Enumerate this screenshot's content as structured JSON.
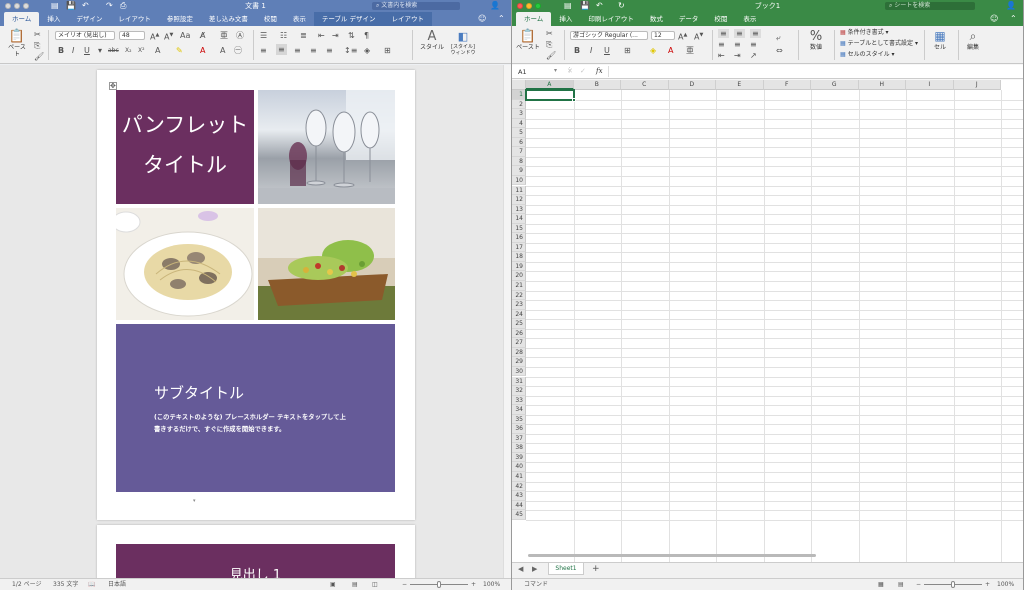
{
  "word": {
    "title": "文書 1",
    "search_placeholder": "文書内を検索",
    "tabs": [
      "ホーム",
      "挿入",
      "デザイン",
      "レイアウト",
      "参照設定",
      "差し込み文書",
      "校閲",
      "表示",
      "テーブル デザイン",
      "レイアウト"
    ],
    "active_tab_index": 0,
    "ribbon": {
      "paste_label": "ペースト",
      "font_name": "メイリオ (見出し)",
      "font_size": "48",
      "styles_label": "スタイル",
      "styles_window_label": "[スタイル]\nウィンドウ"
    },
    "document": {
      "cover_title_line1": "パンフレット",
      "cover_title_line2": "タイトル",
      "subtitle": "サブタイトル",
      "body_line1": "(このテキストのような) プレースホルダー テキストをタップして上",
      "body_line2": "書きするだけで、すぐに作成を開始できます。",
      "heading1": "見出し 1"
    },
    "status": {
      "page": "1/2 ページ",
      "words": "335 文字",
      "language": "日本語",
      "zoom": "100%"
    },
    "colors": {
      "cover": "#6b2f60",
      "subtitle_panel": "#655a98",
      "brand": "#2b579a"
    }
  },
  "excel": {
    "title": "ブック1",
    "search_placeholder": "シートを検索",
    "tabs": [
      "ホーム",
      "挿入",
      "印刷レイアウト",
      "数式",
      "データ",
      "校閲",
      "表示"
    ],
    "active_tab_index": 0,
    "ribbon": {
      "paste_label": "ペースト",
      "font_name": "游ゴシック Regular (...",
      "font_size": "12",
      "number_label": "数値",
      "conditional_format": "条件付き書式",
      "format_as_table": "テーブルとして書式設定",
      "cell_styles": "セルのスタイル",
      "cells_label": "セル",
      "edit_label": "編集"
    },
    "name_box": "A1",
    "fx_label": "fx",
    "columns": [
      "A",
      "B",
      "C",
      "D",
      "E",
      "F",
      "G",
      "H",
      "I",
      "J"
    ],
    "rows": [
      "1",
      "2",
      "3",
      "4",
      "5",
      "6",
      "7",
      "8",
      "9",
      "10",
      "11",
      "12",
      "13",
      "14",
      "15",
      "16",
      "17",
      "18",
      "19",
      "20",
      "21",
      "22",
      "23",
      "24",
      "25",
      "26",
      "27",
      "28",
      "29",
      "30",
      "31",
      "32",
      "33",
      "34",
      "35",
      "36",
      "37",
      "38",
      "39",
      "40",
      "41",
      "42",
      "43",
      "44",
      "45"
    ],
    "sheet_tab": "Sheet1",
    "add_sheet": "+",
    "status": {
      "mode": "コマンド",
      "zoom": "100%"
    },
    "colors": {
      "brand": "#217346"
    }
  }
}
